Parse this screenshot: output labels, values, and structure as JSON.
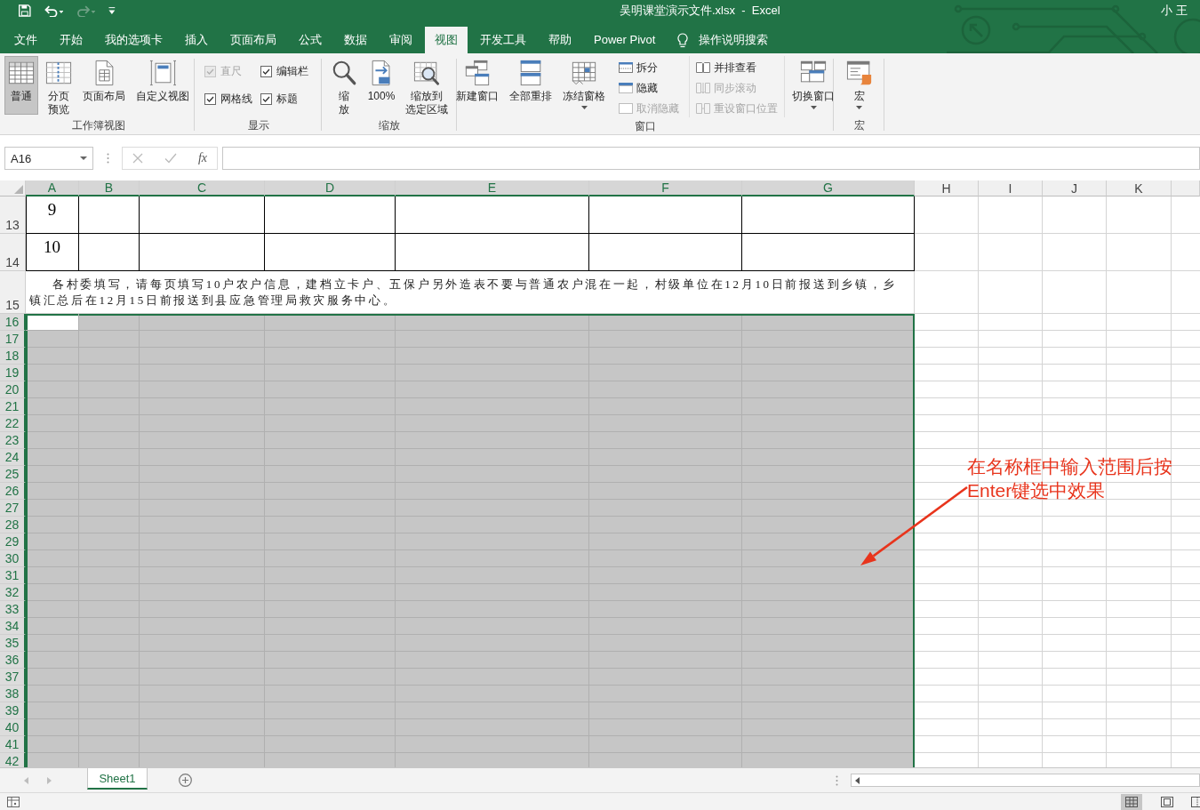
{
  "window": {
    "title": "吴明课堂演示文件.xlsx  -  Excel",
    "user": "小王"
  },
  "quick_access": [
    {
      "kind": "save",
      "disabled": false
    },
    {
      "kind": "undo",
      "disabled": false
    },
    {
      "kind": "redo",
      "disabled": true
    },
    {
      "kind": "customize",
      "disabled": false
    }
  ],
  "tabs": [
    {
      "label": "文件",
      "selected": false
    },
    {
      "label": "开始",
      "selected": false
    },
    {
      "label": "我的选项卡",
      "selected": false
    },
    {
      "label": "插入",
      "selected": false
    },
    {
      "label": "页面布局",
      "selected": false
    },
    {
      "label": "公式",
      "selected": false
    },
    {
      "label": "数据",
      "selected": false
    },
    {
      "label": "审阅",
      "selected": false
    },
    {
      "label": "视图",
      "selected": true
    },
    {
      "label": "开发工具",
      "selected": false
    },
    {
      "label": "帮助",
      "selected": false
    },
    {
      "label": "Power Pivot",
      "selected": false
    }
  ],
  "tell_me": {
    "label": "操作说明搜索"
  },
  "ribbon": {
    "groups": [
      {
        "label": "工作簿视图",
        "items": [
          {
            "kind": "large",
            "lines": [
              "普通"
            ],
            "selected": true,
            "menu": false
          },
          {
            "kind": "large",
            "lines": [
              "分页",
              "预览"
            ],
            "selected": false,
            "menu": false
          },
          {
            "kind": "large",
            "lines": [
              "页面布局"
            ],
            "selected": false,
            "menu": false
          },
          {
            "kind": "large",
            "lines": [
              "自定义视图"
            ],
            "selected": false,
            "menu": false
          }
        ]
      },
      {
        "label": "显示",
        "items": [
          {
            "kind": "check",
            "label": "直尺",
            "checked": true,
            "disabled": true
          },
          {
            "kind": "check",
            "label": "编辑栏",
            "checked": true,
            "disabled": false
          },
          {
            "kind": "check",
            "label": "网格线",
            "checked": true,
            "disabled": false
          },
          {
            "kind": "check",
            "label": "标题",
            "checked": true,
            "disabled": false
          }
        ]
      },
      {
        "label": "缩放",
        "items": [
          {
            "kind": "large",
            "lines": [
              "缩",
              "放"
            ],
            "selected": false,
            "menu": false
          },
          {
            "kind": "large",
            "lines": [
              "100%"
            ],
            "selected": false,
            "menu": false
          },
          {
            "kind": "large",
            "lines": [
              "缩放到",
              "选定区域"
            ],
            "selected": false,
            "menu": false
          }
        ]
      },
      {
        "label": "窗口",
        "items": [
          {
            "kind": "large",
            "lines": [
              "新建窗口"
            ],
            "selected": false,
            "menu": false
          },
          {
            "kind": "large",
            "lines": [
              "全部重排"
            ],
            "selected": false,
            "menu": false
          },
          {
            "kind": "large",
            "lines": [
              "冻结窗格"
            ],
            "selected": false,
            "menu": true
          },
          {
            "kind": "small",
            "label": "拆分",
            "disabled": false
          },
          {
            "kind": "small",
            "label": "隐藏",
            "disabled": false
          },
          {
            "kind": "small",
            "label": "取消隐藏",
            "disabled": true
          },
          {
            "kind": "small",
            "label": "并排查看",
            "disabled": false
          },
          {
            "kind": "small",
            "label": "同步滚动",
            "disabled": true
          },
          {
            "kind": "small",
            "label": "重设窗口位置",
            "disabled": true
          },
          {
            "kind": "large",
            "lines": [
              "切换窗口"
            ],
            "selected": false,
            "menu": true
          }
        ]
      },
      {
        "label": "宏",
        "items": [
          {
            "kind": "large",
            "lines": [
              "宏"
            ],
            "selected": false,
            "menu": true
          }
        ]
      }
    ]
  },
  "formula_bar": {
    "name_box": "A16",
    "buttons": [
      {
        "kind": "cancel",
        "disabled": true
      },
      {
        "kind": "enter",
        "disabled": true
      },
      {
        "kind": "function",
        "label": "fx",
        "disabled": false
      }
    ]
  },
  "sheet": {
    "columns": [
      {
        "label": "A",
        "selected": true
      },
      {
        "label": "B",
        "selected": true
      },
      {
        "label": "C",
        "selected": true
      },
      {
        "label": "D",
        "selected": true
      },
      {
        "label": "E",
        "selected": true
      },
      {
        "label": "F",
        "selected": true
      },
      {
        "label": "G",
        "selected": true
      },
      {
        "label": "H",
        "selected": false
      },
      {
        "label": "I",
        "selected": false
      },
      {
        "label": "J",
        "selected": false
      },
      {
        "label": "K",
        "selected": false
      }
    ],
    "rows": [
      {
        "label": "13",
        "kind": "table",
        "selected": false,
        "cells": [
          {
            "text": "9",
            "active": false
          }
        ]
      },
      {
        "label": "14",
        "kind": "table",
        "selected": false,
        "cells": [
          {
            "text": "10",
            "active": false
          }
        ]
      },
      {
        "label": "15",
        "kind": "note",
        "selected": false,
        "text": "各村委填写，请每页填写10户农户信息，建档立卡户、五保户另外造表不要与普通农户混在一起，村级单位在12月10日前报送到乡镇，乡镇汇总后在12月15日前报送到县应急管理局救灾服务中心。"
      },
      {
        "label": "16",
        "kind": "empty",
        "selected": true,
        "cells": [
          {
            "active": true
          }
        ]
      },
      {
        "label": "17",
        "kind": "empty",
        "selected": true
      },
      {
        "label": "18",
        "kind": "empty",
        "selected": true
      },
      {
        "label": "19",
        "kind": "empty",
        "selected": true
      },
      {
        "label": "20",
        "kind": "empty",
        "selected": true
      },
      {
        "label": "21",
        "kind": "empty",
        "selected": true
      },
      {
        "label": "22",
        "kind": "empty",
        "selected": true
      },
      {
        "label": "23",
        "kind": "empty",
        "selected": true
      },
      {
        "label": "24",
        "kind": "empty",
        "selected": true
      },
      {
        "label": "25",
        "kind": "empty",
        "selected": true
      },
      {
        "label": "26",
        "kind": "empty",
        "selected": true
      },
      {
        "label": "27",
        "kind": "empty",
        "selected": true
      },
      {
        "label": "28",
        "kind": "empty",
        "selected": true
      },
      {
        "label": "29",
        "kind": "empty",
        "selected": true
      },
      {
        "label": "30",
        "kind": "empty",
        "selected": true
      },
      {
        "label": "31",
        "kind": "empty",
        "selected": true
      },
      {
        "label": "32",
        "kind": "empty",
        "selected": true
      },
      {
        "label": "33",
        "kind": "empty",
        "selected": true
      },
      {
        "label": "34",
        "kind": "empty",
        "selected": true
      },
      {
        "label": "35",
        "kind": "empty",
        "selected": true
      },
      {
        "label": "36",
        "kind": "empty",
        "selected": true
      },
      {
        "label": "37",
        "kind": "empty",
        "selected": true
      },
      {
        "label": "38",
        "kind": "empty",
        "selected": true
      },
      {
        "label": "39",
        "kind": "empty",
        "selected": true
      },
      {
        "label": "40",
        "kind": "empty",
        "selected": true
      },
      {
        "label": "41",
        "kind": "empty",
        "selected": true
      },
      {
        "label": "42",
        "kind": "empty",
        "selected": true
      }
    ]
  },
  "sheet_tabs": [
    {
      "label": "Sheet1",
      "selected": true
    }
  ],
  "status_bar": {
    "views": [
      {
        "kind": "normal",
        "selected": true
      },
      {
        "kind": "page_layout",
        "selected": false
      },
      {
        "kind": "page_break",
        "selected": false
      }
    ]
  },
  "annotation": {
    "lines": [
      "在名称框中输入范围后按",
      "Enter键选中效果"
    ]
  }
}
